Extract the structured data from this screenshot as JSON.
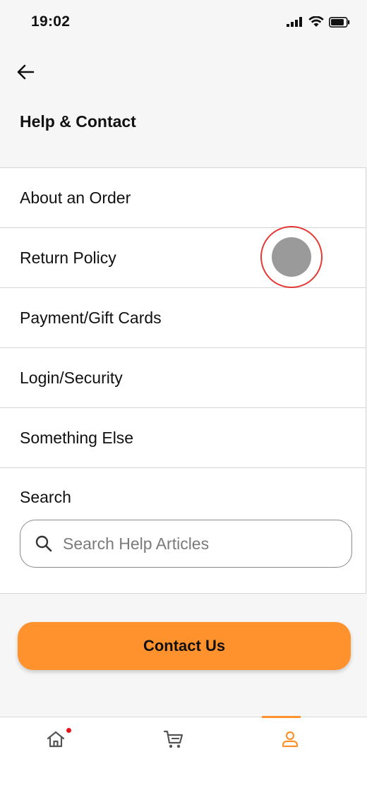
{
  "status_bar": {
    "time": "19:02",
    "icons": [
      "signal-icon",
      "wifi-icon",
      "battery-icon"
    ]
  },
  "header": {
    "back_icon": "arrow-left-icon",
    "title": "Help & Contact"
  },
  "menu": {
    "items": [
      {
        "label": "About an Order"
      },
      {
        "label": "Return Policy"
      },
      {
        "label": "Payment/Gift Cards"
      },
      {
        "label": "Login/Security"
      },
      {
        "label": "Something Else"
      }
    ]
  },
  "search": {
    "label": "Search",
    "placeholder": "Search Help Articles",
    "icon": "search-icon"
  },
  "contact_button": {
    "label": "Contact Us"
  },
  "tab_bar": {
    "tabs": [
      {
        "icon": "home-icon",
        "has_notification": true
      },
      {
        "icon": "cart-icon"
      },
      {
        "icon": "account-icon",
        "active": true
      }
    ]
  },
  "colors": {
    "accent": "#ff922d",
    "notification": "#e8141b",
    "touch_ring": "#e53935"
  }
}
